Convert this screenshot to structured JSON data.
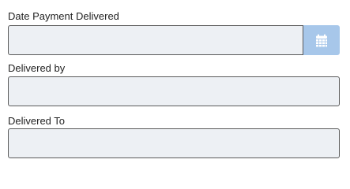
{
  "form": {
    "date_payment_delivered": {
      "label": "Date Payment Delivered",
      "value": "",
      "button_icon": "calendar-icon"
    },
    "delivered_by": {
      "label": "Delivered by",
      "value": ""
    },
    "delivered_to": {
      "label": "Delivered To",
      "value": ""
    }
  },
  "colors": {
    "field_background": "#edf0f4",
    "field_border": "#5a5a5a",
    "calendar_button_background": "#a7c7ea",
    "calendar_icon": "#ffffff"
  }
}
